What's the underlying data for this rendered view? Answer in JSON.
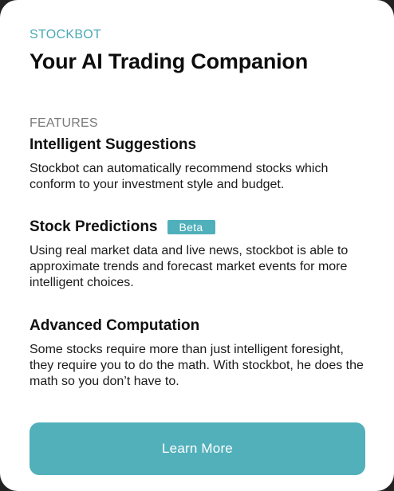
{
  "card": {
    "brand": "STOCKBOT",
    "headline": "Your AI Trading Companion",
    "section_label": "FEATURES",
    "features": [
      {
        "title": "Intelligent Suggestions",
        "badge": "",
        "description": "Stockbot can automatically recommend stocks which conform to your investment style and budget."
      },
      {
        "title": "Stock Predictions",
        "badge": "Beta",
        "description": "Using real market data and live news, stockbot is able to approximate trends and forecast market events for more intelligent choices."
      },
      {
        "title": "Advanced Computation",
        "badge": "",
        "description": "Some stocks require more than just intelligent foresight, they require you to do the math. With stockbot, he does the math so you don’t have to."
      }
    ],
    "cta_label": "Learn More"
  },
  "colors": {
    "accent": "#4fb0bb",
    "background": "#ffffff",
    "section_label": "#7a7a7a"
  }
}
